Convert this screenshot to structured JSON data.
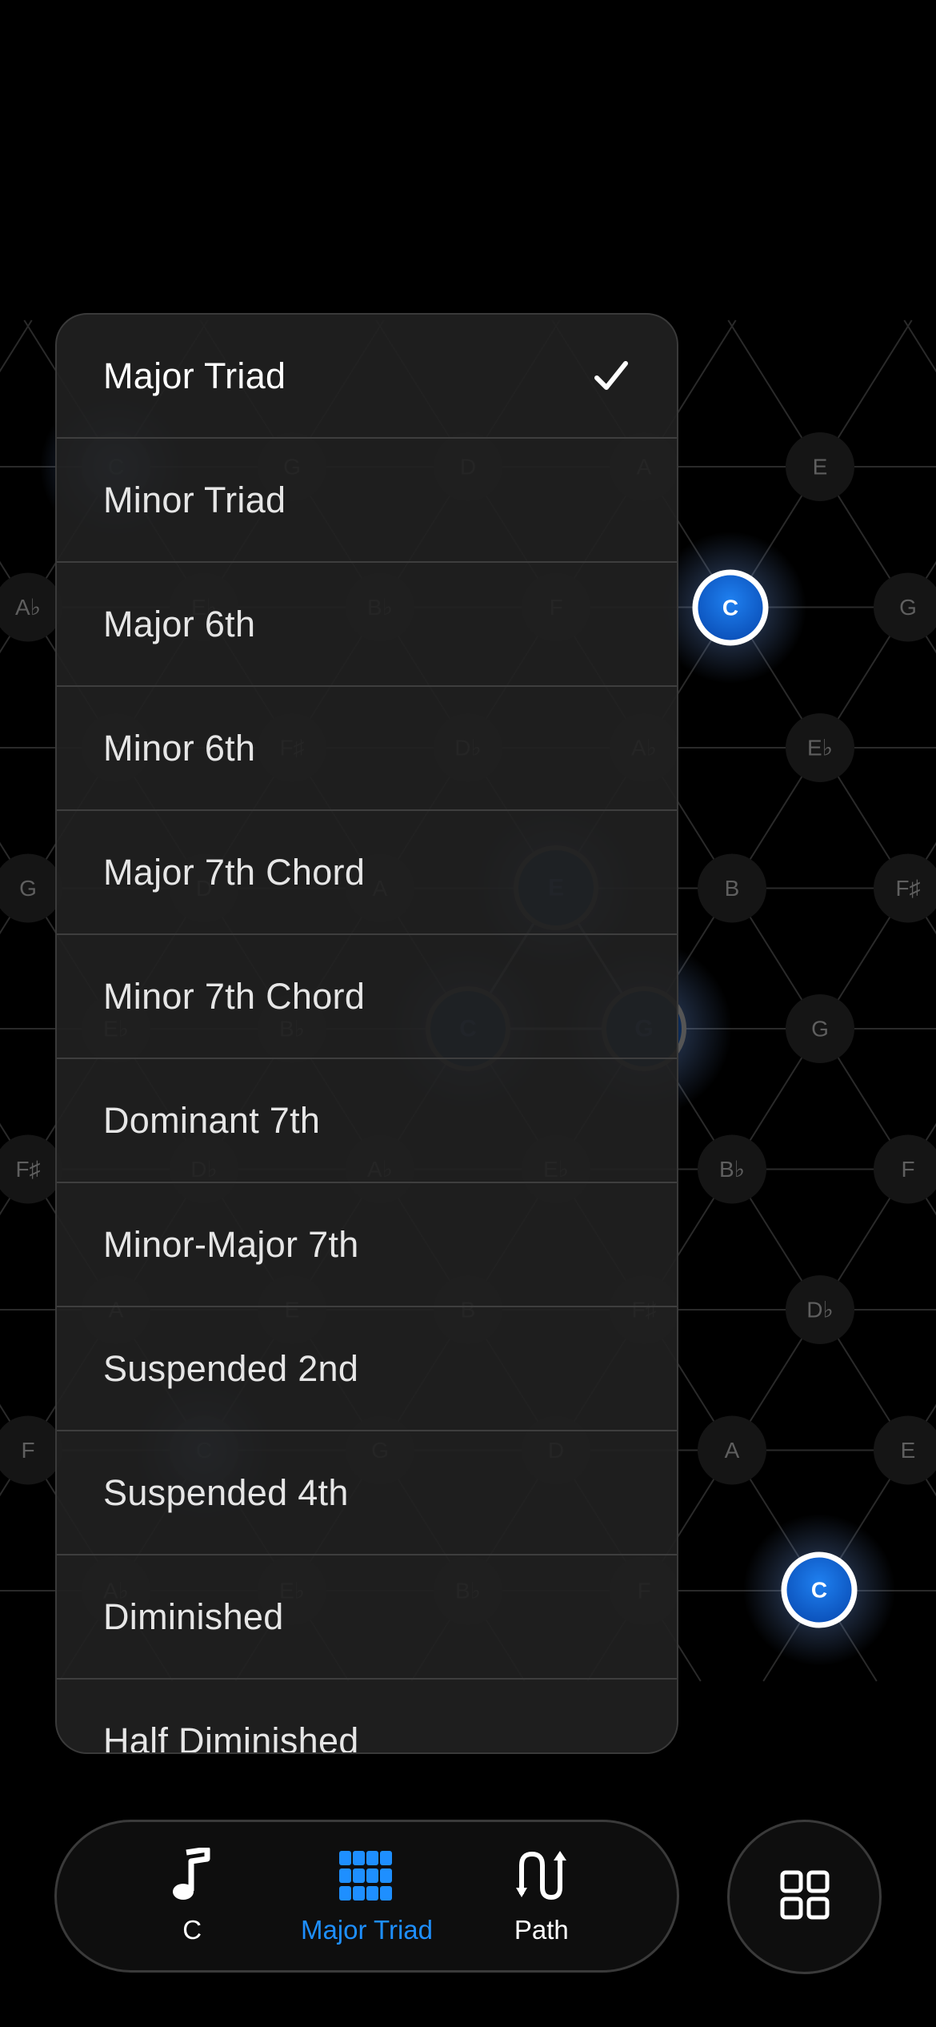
{
  "lattice": {
    "nodes": [
      {
        "row": 0,
        "col": 0,
        "label": "C"
      },
      {
        "row": 0,
        "col": 1,
        "label": "G"
      },
      {
        "row": 0,
        "col": 2,
        "label": "D"
      },
      {
        "row": 0,
        "col": 3,
        "label": "A"
      },
      {
        "row": 0,
        "col": 4,
        "label": "E"
      },
      {
        "row": 1,
        "col": 0,
        "label": "A♭"
      },
      {
        "row": 1,
        "col": 1,
        "label": "E♭"
      },
      {
        "row": 1,
        "col": 2,
        "label": "B♭"
      },
      {
        "row": 1,
        "col": 3,
        "label": "F"
      },
      {
        "row": 1,
        "col": 4,
        "label": "C"
      },
      {
        "row": 1,
        "col": 5,
        "label": "G"
      },
      {
        "row": 2,
        "col": 0,
        "label": "B"
      },
      {
        "row": 2,
        "col": 1,
        "label": "F♯"
      },
      {
        "row": 2,
        "col": 2,
        "label": "D♭"
      },
      {
        "row": 2,
        "col": 3,
        "label": "A♭"
      },
      {
        "row": 2,
        "col": 4,
        "label": "E♭"
      },
      {
        "row": 3,
        "col": 0,
        "label": "G"
      },
      {
        "row": 3,
        "col": 1,
        "label": "D"
      },
      {
        "row": 3,
        "col": 2,
        "label": "A"
      },
      {
        "row": 3,
        "col": 3,
        "label": "E"
      },
      {
        "row": 3,
        "col": 4,
        "label": "B"
      },
      {
        "row": 3,
        "col": 5,
        "label": "F♯"
      },
      {
        "row": 4,
        "col": 0,
        "label": "E♭"
      },
      {
        "row": 4,
        "col": 1,
        "label": "B♭"
      },
      {
        "row": 4,
        "col": 2,
        "label": "F"
      },
      {
        "row": 4,
        "col": 3,
        "label": "C"
      },
      {
        "row": 4,
        "col": 4,
        "label": "G"
      },
      {
        "row": 4,
        "col": 5,
        "label": "D"
      },
      {
        "row": 5,
        "col": 0,
        "label": "F♯"
      },
      {
        "row": 5,
        "col": 1,
        "label": "D♭"
      },
      {
        "row": 5,
        "col": 2,
        "label": "A♭"
      },
      {
        "row": 5,
        "col": 3,
        "label": "E♭"
      },
      {
        "row": 5,
        "col": 4,
        "label": "B♭"
      },
      {
        "row": 5,
        "col": 5,
        "label": "F"
      },
      {
        "row": 6,
        "col": 0,
        "label": "A"
      },
      {
        "row": 6,
        "col": 1,
        "label": "E"
      },
      {
        "row": 6,
        "col": 2,
        "label": "B"
      },
      {
        "row": 6,
        "col": 3,
        "label": "F♯"
      },
      {
        "row": 6,
        "col": 4,
        "label": "D♭"
      },
      {
        "row": 7,
        "col": 0,
        "label": "F"
      },
      {
        "row": 7,
        "col": 1,
        "label": "C"
      },
      {
        "row": 7,
        "col": 2,
        "label": "G"
      },
      {
        "row": 7,
        "col": 3,
        "label": "D"
      },
      {
        "row": 7,
        "col": 4,
        "label": "A"
      },
      {
        "row": 7,
        "col": 5,
        "label": "E"
      },
      {
        "row": 8,
        "col": 0,
        "label": "A♭"
      },
      {
        "row": 8,
        "col": 1,
        "label": "E♭"
      },
      {
        "row": 8,
        "col": 2,
        "label": "B♭"
      },
      {
        "row": 8,
        "col": 3,
        "label": "F"
      },
      {
        "row": 8,
        "col": 4,
        "label": "C"
      }
    ],
    "active_label": "C",
    "chord_labels": [
      "C",
      "E",
      "G"
    ]
  },
  "menu": {
    "items": [
      {
        "label": "Major Triad",
        "selected": true
      },
      {
        "label": "Minor Triad",
        "selected": false
      },
      {
        "label": "Major 6th",
        "selected": false
      },
      {
        "label": "Minor 6th",
        "selected": false
      },
      {
        "label": "Major 7th Chord",
        "selected": false
      },
      {
        "label": "Minor 7th Chord",
        "selected": false
      },
      {
        "label": "Dominant 7th",
        "selected": false
      },
      {
        "label": "Minor-Major 7th",
        "selected": false
      },
      {
        "label": "Suspended 2nd",
        "selected": false
      },
      {
        "label": "Suspended 4th",
        "selected": false
      },
      {
        "label": "Diminished",
        "selected": false
      },
      {
        "label": "Half Diminished",
        "selected": false
      }
    ]
  },
  "tabbar": {
    "root_label": "C",
    "chord_label": "Major Triad",
    "path_label": "Path"
  },
  "icons": {
    "check": "checkmark-icon",
    "root": "music-note-icon",
    "chord": "grid-dots-icon",
    "path": "path-arrows-icon",
    "layout": "four-squares-icon"
  },
  "colors": {
    "accent": "#1e8fff",
    "active_node": "#0a5fd0",
    "background": "#000000",
    "menu_bg": "#202020"
  }
}
